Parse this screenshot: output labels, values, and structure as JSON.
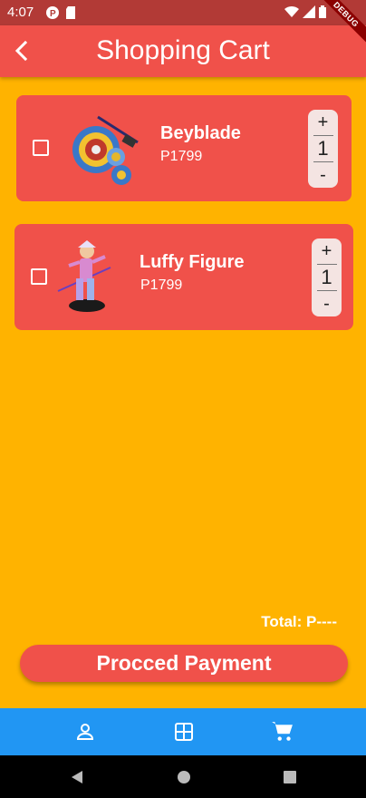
{
  "status_bar": {
    "time": "4:07",
    "icons": [
      "notification-p-icon",
      "sd-card-icon",
      "wifi-icon",
      "signal-icon",
      "battery-icon"
    ]
  },
  "debug_banner": {
    "label": "DEBUG"
  },
  "app_bar": {
    "title": "Shopping Cart",
    "back_icon": "chevron-left-icon",
    "color": "#F0514A"
  },
  "cart": {
    "items": [
      {
        "name": "Beyblade",
        "price": "P1799",
        "quantity": "1",
        "checked": false,
        "inc_label": "+",
        "dec_label": "-",
        "image": "beyblade-image"
      },
      {
        "name": "Luffy Figure",
        "price": "P1799",
        "quantity": "1",
        "checked": false,
        "inc_label": "+",
        "dec_label": "-",
        "image": "luffy-figure-image"
      }
    ]
  },
  "summary": {
    "total_text": "Total: P----"
  },
  "actions": {
    "pay_label": "Procced Payment"
  },
  "bottom_nav": {
    "items": [
      {
        "icon": "person-icon"
      },
      {
        "icon": "grid-icon"
      },
      {
        "icon": "cart-icon"
      }
    ],
    "color": "#2196F3"
  },
  "system_nav": {
    "buttons": [
      "back-triangle-icon",
      "home-circle-icon",
      "recents-square-icon"
    ]
  },
  "colors": {
    "background": "#FFB300",
    "accent": "#F0514A",
    "nav": "#2196F3",
    "status_bar": "#B23A36"
  }
}
